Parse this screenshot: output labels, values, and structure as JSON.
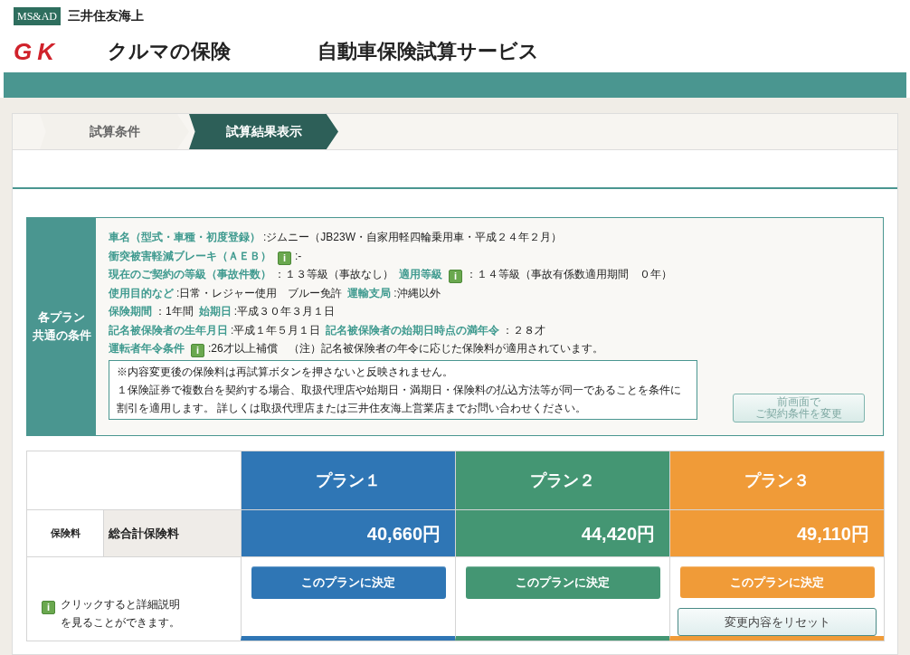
{
  "header": {
    "brand_badge": "MS&AD",
    "company": "三井住友海上",
    "logo_letters": "GK",
    "product": "クルマの保険",
    "service_title": "自動車保険試算サービス"
  },
  "steps": [
    {
      "label": "試算条件",
      "selected": false
    },
    {
      "label": "試算結果表示",
      "selected": true
    }
  ],
  "conditions": {
    "heading": [
      "各プラン",
      "共通の条件"
    ],
    "lines": [
      [
        {
          "kind": "label",
          "text": "車名（型式・車種・初度登録）"
        },
        {
          "kind": "value",
          "text": ":ジムニー（JB23W・自家用軽四輪乗用車・平成２４年２月）"
        }
      ],
      [
        {
          "kind": "label",
          "text": "衝突被害軽減ブレーキ（ＡＥＢ）"
        },
        {
          "kind": "info",
          "text": "i"
        },
        {
          "kind": "value",
          "text": ":-"
        }
      ],
      [
        {
          "kind": "label",
          "text": "現在のご契約の等級（事故件数）"
        },
        {
          "kind": "value",
          "text": "：１３等級（事故なし）"
        },
        {
          "kind": "label",
          "text": "適用等級"
        },
        {
          "kind": "info",
          "text": "i"
        },
        {
          "kind": "value",
          "text": "：１４等級（事故有係数適用期間　０年）"
        }
      ],
      [
        {
          "kind": "label",
          "text": "使用目的など"
        },
        {
          "kind": "value",
          "text": ":日常・レジャー使用　ブルー免許"
        },
        {
          "kind": "label",
          "text": "運輸支局"
        },
        {
          "kind": "value",
          "text": ":沖縄以外"
        }
      ],
      [
        {
          "kind": "label",
          "text": "保険期間"
        },
        {
          "kind": "value",
          "text": "：1年間"
        },
        {
          "kind": "label",
          "text": "始期日"
        },
        {
          "kind": "value",
          "text": ":平成３０年３月１日"
        }
      ],
      [
        {
          "kind": "label",
          "text": "記名被保険者の生年月日"
        },
        {
          "kind": "value",
          "text": ":平成１年５月１日"
        },
        {
          "kind": "label",
          "text": "記名被保険者の始期日時点の満年令"
        },
        {
          "kind": "value",
          "text": "：２８才"
        }
      ],
      [
        {
          "kind": "label",
          "text": "運転者年令条件"
        },
        {
          "kind": "info",
          "text": "i"
        },
        {
          "kind": "value",
          "text": ":26才以上補償　（注）記名被保険者の年令に応じた保険料が適用されています。"
        }
      ]
    ],
    "notes": [
      "※内容変更後の保険料は再試算ボタンを押さないと反映されません。",
      "１保険証券で複数台を契約する場合、取扱代理店や始期日・満期日・保険料の払込方法等が同一であることを条件に割引を適用します。 詳しくは取扱代理店または三井住友海上営業店までお問い合わせください。"
    ],
    "change_button": [
      "前画面で",
      "ご契約条件を変更"
    ]
  },
  "plans_table": {
    "row_label": "保険料",
    "row_sublabel": "総合計保険料",
    "help_icon": "i",
    "help_text": [
      "クリックすると詳細説明",
      "を見ることができます。"
    ],
    "plans": [
      {
        "name": "プラン１",
        "color": "#2f76b5",
        "premium": "40,660円",
        "decide_button": "このプランに決定"
      },
      {
        "name": "プラン２",
        "color": "#449673",
        "premium": "44,420円",
        "decide_button": "このプランに決定"
      },
      {
        "name": "プラン３",
        "color": "#f09b38",
        "premium": "49,110円",
        "decide_button": "このプランに決定",
        "reset_button": "変更内容をリセット"
      }
    ]
  }
}
